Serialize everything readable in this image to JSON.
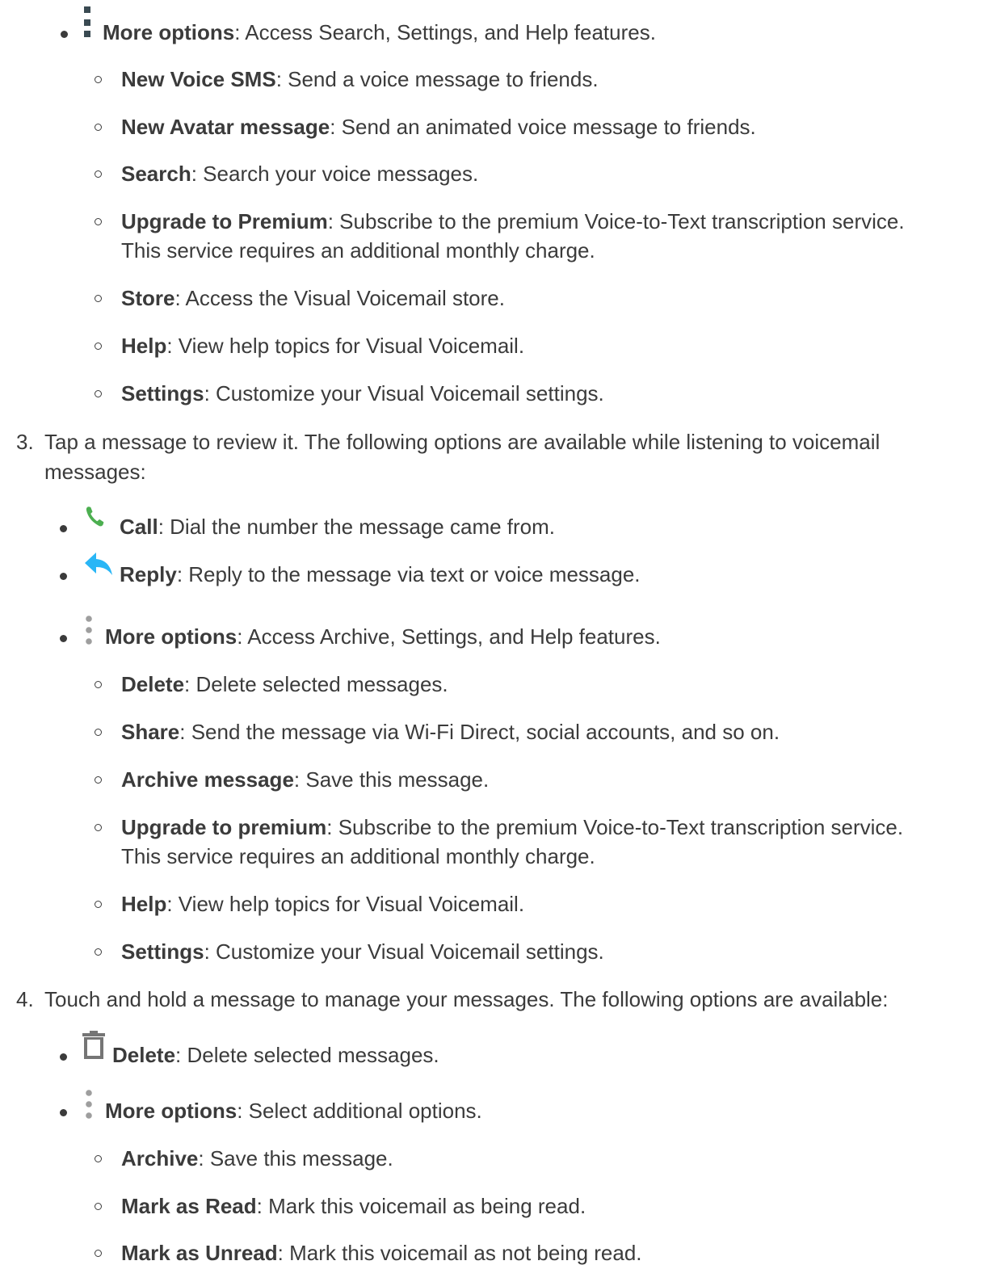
{
  "sections": [
    {
      "bullets": [
        {
          "icon": "more-options-icon",
          "label": "More options",
          "desc": ": Access Search, Settings, and Help features.",
          "sub": [
            {
              "label": "New Voice SMS",
              "desc": ": Send a voice message to friends."
            },
            {
              "label": "New Avatar message",
              "desc": ": Send an animated voice message to friends."
            },
            {
              "label": "Search",
              "desc": ": Search your voice messages."
            },
            {
              "label": "Upgrade to Premium",
              "desc": ": Subscribe to the premium Voice-to-Text transcription service.",
              "desc2": "This service requires an additional monthly charge."
            },
            {
              "label": "Store",
              "desc": ": Access the Visual Voicemail store."
            },
            {
              "label": "Help",
              "desc": ": View help topics for Visual Voicemail."
            },
            {
              "label": "Settings",
              "desc": ": Customize your Visual Voicemail settings."
            }
          ]
        }
      ]
    },
    {
      "number": "3.",
      "text": "Tap a message to review it. The following options are available while listening to voicemail",
      "text2": "messages:",
      "bullets": [
        {
          "icon": "call-icon",
          "label": "Call",
          "desc": ": Dial the number the message came from."
        },
        {
          "icon": "reply-icon",
          "label": "Reply",
          "desc": ": Reply to the message via text or voice message."
        },
        {
          "icon": "more-options-icon",
          "label": "More options",
          "desc": ": Access Archive, Settings, and Help features.",
          "sub": [
            {
              "label": "Delete",
              "desc": ": Delete selected messages."
            },
            {
              "label": "Share",
              "desc": ": Send the message via Wi-Fi Direct, social accounts, and so on."
            },
            {
              "label": "Archive message",
              "desc": ": Save this message."
            },
            {
              "label": "Upgrade to premium",
              "desc": ": Subscribe to the premium Voice-to-Text transcription service.",
              "desc2": "This service requires an additional monthly charge."
            },
            {
              "label": "Help",
              "desc": ": View help topics for Visual Voicemail."
            },
            {
              "label": "Settings",
              "desc": ": Customize your Visual Voicemail settings."
            }
          ]
        }
      ]
    },
    {
      "number": "4.",
      "text": "Touch and hold a message to manage your messages. The following options are available:",
      "bullets": [
        {
          "icon": "trash-icon",
          "label": "Delete",
          "desc": ": Delete selected messages."
        },
        {
          "icon": "more-options-icon",
          "label": "More options",
          "desc": ": Select additional options.",
          "sub": [
            {
              "label": "Archive",
              "desc": ": Save this message."
            },
            {
              "label": "Mark as Read",
              "desc": ": Mark this voicemail as being read."
            },
            {
              "label": "Mark as Unread",
              "desc": ": Mark this voicemail as not being read."
            }
          ]
        }
      ]
    }
  ],
  "colors": {
    "text": "#3b3b3b",
    "call_icon": "#4caf50",
    "reply_icon": "#29b6f6",
    "more_icon_dark": "#3a4a52",
    "more_icon_light": "#9e9e9e",
    "trash_icon": "#757575"
  }
}
